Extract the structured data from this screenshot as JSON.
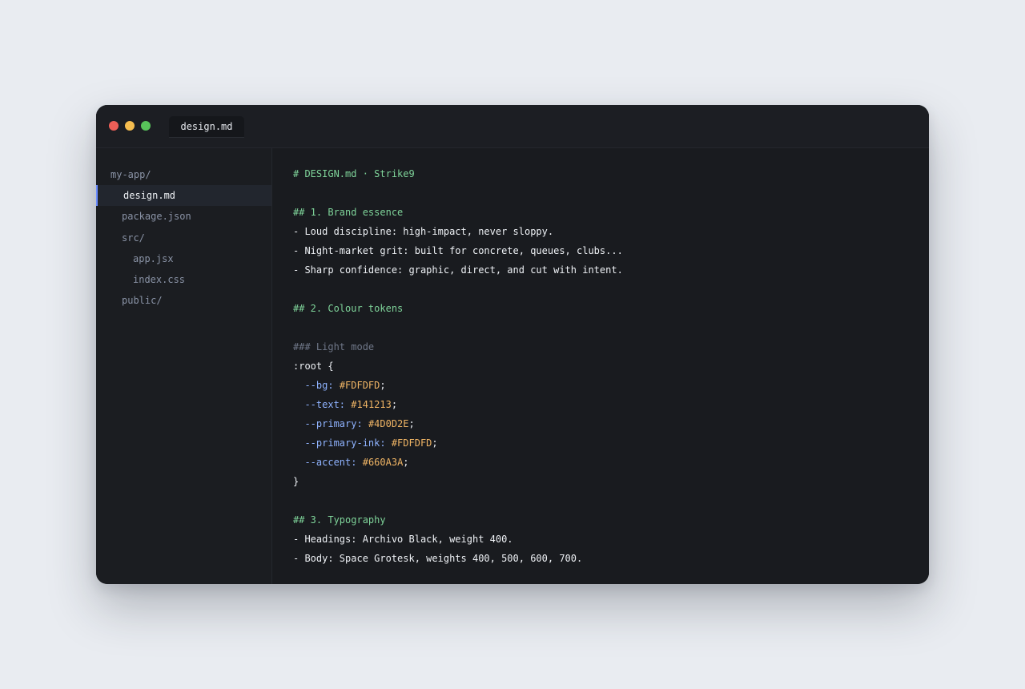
{
  "window": {
    "traffic_lights": {
      "close_color": "#ee5f57",
      "minimize_color": "#f5bd4f",
      "maximize_color": "#58c35a"
    },
    "tab_label": "design.md"
  },
  "sidebar": {
    "items": [
      {
        "label": "my-app/",
        "indent": 0,
        "active": false
      },
      {
        "label": "design.md",
        "indent": 1,
        "active": true
      },
      {
        "label": "package.json",
        "indent": 1,
        "active": false
      },
      {
        "label": "src/",
        "indent": 1,
        "active": false
      },
      {
        "label": "app.jsx",
        "indent": 2,
        "active": false
      },
      {
        "label": "index.css",
        "indent": 2,
        "active": false
      },
      {
        "label": "public/",
        "indent": 1,
        "active": false
      }
    ]
  },
  "editor": {
    "lines": [
      [
        {
          "t": "# DESIGN.md · Strike9",
          "c": "h2"
        }
      ],
      [],
      [
        {
          "t": "## 1. Brand essence",
          "c": "h2"
        }
      ],
      [
        {
          "t": "- Loud discipline: high-impact, never sloppy.",
          "c": "text"
        }
      ],
      [
        {
          "t": "- Night-market grit: built for concrete, queues, clubs...",
          "c": "text"
        }
      ],
      [
        {
          "t": "- Sharp confidence: graphic, direct, and cut with intent.",
          "c": "text"
        }
      ],
      [],
      [
        {
          "t": "## 2. Colour tokens",
          "c": "h2"
        }
      ],
      [],
      [
        {
          "t": "### Light mode",
          "c": "h3"
        }
      ],
      [
        {
          "t": ":root {",
          "c": "text"
        }
      ],
      [
        {
          "t": "  --bg:",
          "c": "prop"
        },
        {
          "t": " ",
          "c": "punct"
        },
        {
          "t": "#FDFDFD",
          "c": "val"
        },
        {
          "t": ";",
          "c": "punct"
        }
      ],
      [
        {
          "t": "  --text:",
          "c": "prop"
        },
        {
          "t": " ",
          "c": "punct"
        },
        {
          "t": "#141213",
          "c": "val"
        },
        {
          "t": ";",
          "c": "punct"
        }
      ],
      [
        {
          "t": "  --primary:",
          "c": "prop"
        },
        {
          "t": " ",
          "c": "punct"
        },
        {
          "t": "#4D0D2E",
          "c": "val"
        },
        {
          "t": ";",
          "c": "punct"
        }
      ],
      [
        {
          "t": "  --primary-ink:",
          "c": "prop"
        },
        {
          "t": " ",
          "c": "punct"
        },
        {
          "t": "#FDFDFD",
          "c": "val"
        },
        {
          "t": ";",
          "c": "punct"
        }
      ],
      [
        {
          "t": "  --accent:",
          "c": "prop"
        },
        {
          "t": " ",
          "c": "punct"
        },
        {
          "t": "#660A3A",
          "c": "val"
        },
        {
          "t": ";",
          "c": "punct"
        }
      ],
      [
        {
          "t": "}",
          "c": "text"
        }
      ],
      [],
      [
        {
          "t": "## 3. Typography",
          "c": "h2"
        }
      ],
      [
        {
          "t": "- Headings: Archivo Black, weight 400.",
          "c": "text"
        }
      ],
      [
        {
          "t": "- Body: Space Grotesk, weights 400, 500, 600, 700.",
          "c": "text"
        }
      ]
    ]
  }
}
